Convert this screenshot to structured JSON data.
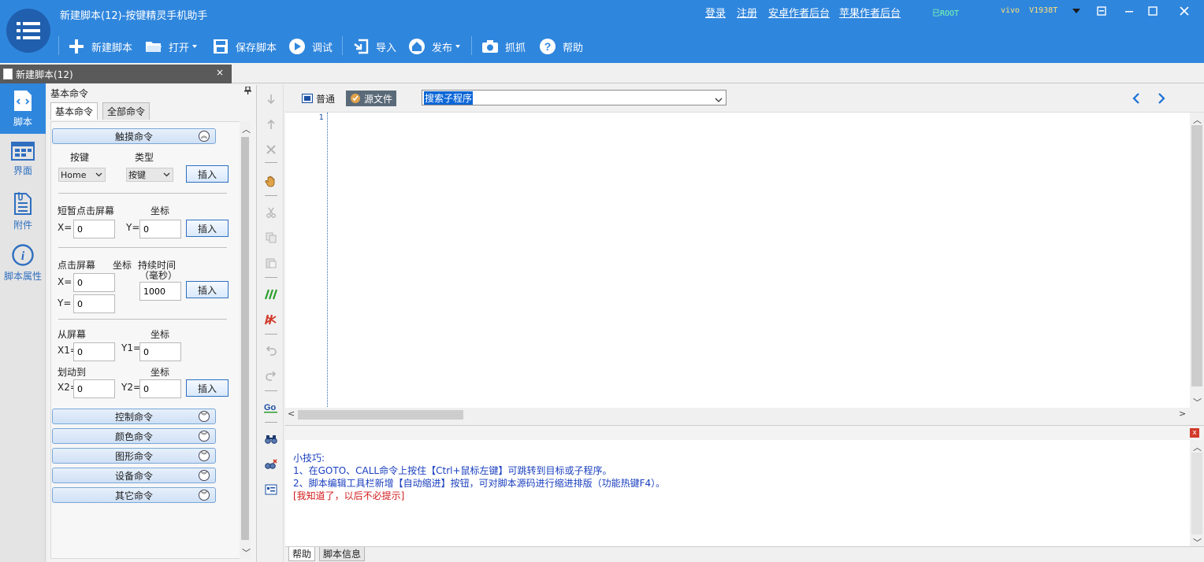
{
  "window": {
    "title": "新建脚本(12)-按键精灵手机助手",
    "links": {
      "login": "登录",
      "register": "注册",
      "android_author": "安卓作者后台",
      "apple_author": "苹果作者后台"
    },
    "root_status": "已ROOT",
    "device": "vivo  V1938T",
    "controls": {
      "restore": "⊡",
      "minimize": "—",
      "maximize": "☐",
      "close": "✕"
    }
  },
  "toolbar": {
    "new_script": "新建脚本",
    "open": "打开",
    "save_script": "保存脚本",
    "debug": "调试",
    "import": "导入",
    "publish": "发布",
    "capture": "抓抓",
    "help": "帮助"
  },
  "doc_tab": {
    "label": "新建脚本(12)",
    "close": "×"
  },
  "left_nav": [
    {
      "label": "脚本",
      "icon": "script-icon"
    },
    {
      "label": "界面",
      "icon": "layout-icon"
    },
    {
      "label": "附件",
      "icon": "attachment-icon"
    },
    {
      "label": "脚本属性",
      "icon": "info-icon"
    }
  ],
  "command_panel": {
    "title": "基本命令",
    "pin": "ᵖ",
    "tabs": [
      "基本命令",
      "全部命令"
    ],
    "touch_section": "触摸命令",
    "key": {
      "label_key": "按键",
      "label_type": "类型",
      "key_value": "Home",
      "type_value": "按键",
      "insert": "插入"
    },
    "tap": {
      "label": "短暂点击屏幕",
      "coord": "坐标",
      "x_label": "X=",
      "y_label": "Y=",
      "x": "0",
      "y": "0",
      "insert": "插入"
    },
    "press": {
      "label": "点击屏幕",
      "coord": "坐标",
      "duration": "持续时间",
      "unit": "（毫秒）",
      "x_label": "X=",
      "y_label": "Y=",
      "x": "0",
      "y": "0",
      "ms": "1000",
      "insert": "插入"
    },
    "swipe": {
      "from": "从屏幕",
      "coord1": "坐标",
      "to": "划动到",
      "coord2": "坐标",
      "x1_label": "X1=",
      "y1_label": "Y1=",
      "x2_label": "X2=",
      "y2_label": "Y2=",
      "x1": "0",
      "y1": "0",
      "x2": "0",
      "y2": "0",
      "insert": "插入"
    },
    "sections": [
      "控制命令",
      "颜色命令",
      "图形命令",
      "设备命令",
      "其它命令"
    ]
  },
  "editor": {
    "mode_normal": "普通",
    "mode_source": "源文件",
    "sub_search": "搜索子程序",
    "line_number": "1"
  },
  "tips": {
    "title": "小技巧:",
    "line1": "1、在GOTO、CALL命令上按住【Ctrl+鼠标左键】可跳转到目标或子程序。",
    "line2": "2、脚本编辑工具栏新增【自动缩进】按钮，可对脚本源码进行缩进排版（功能热键F4）。",
    "dismiss": "[我知道了，以后不必提示]",
    "close": "x"
  },
  "bottom_tabs": [
    "帮助",
    "脚本信息"
  ],
  "colors": {
    "accent": "#2f86dd",
    "dark_accent": "#1f5fae",
    "tip_blue": "#1a3fbf",
    "tip_red": "#d21c1c"
  }
}
